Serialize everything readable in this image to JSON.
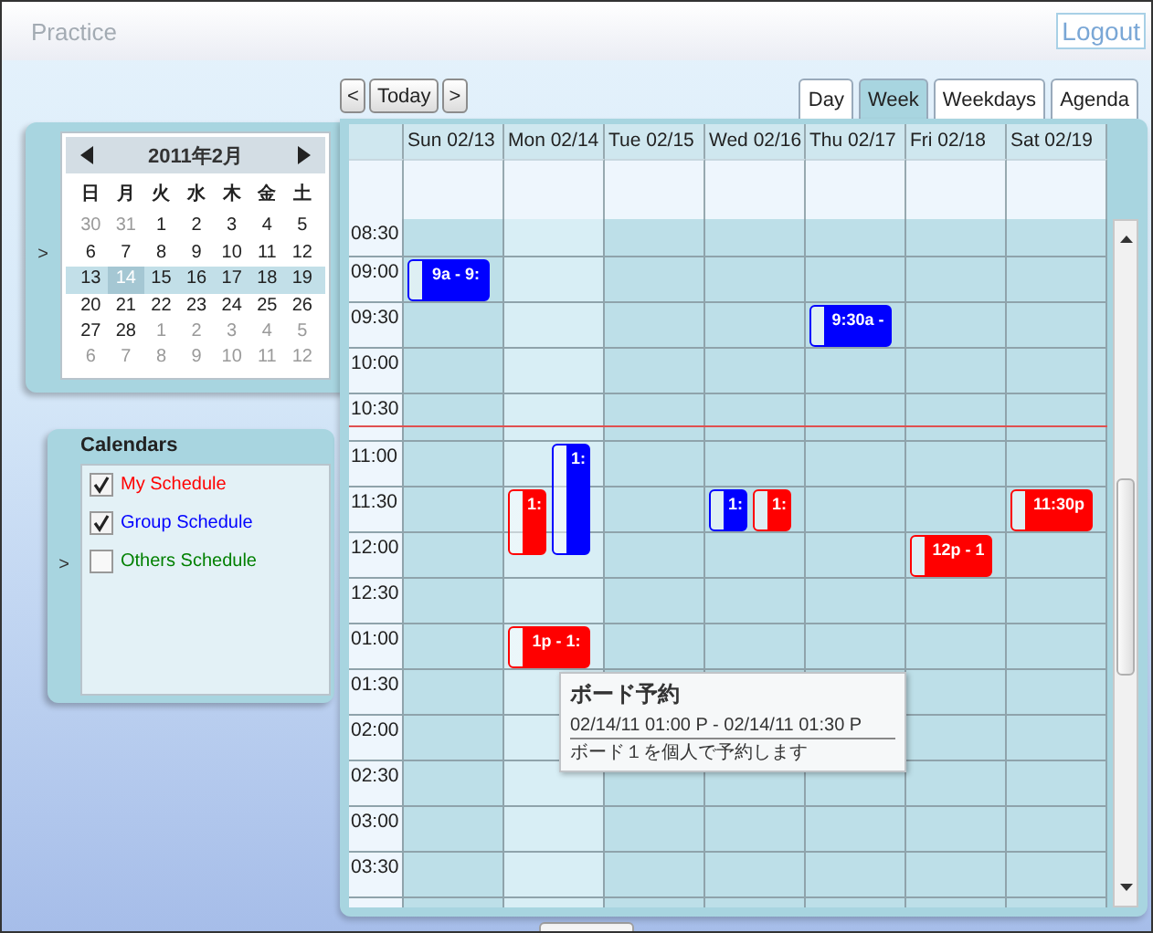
{
  "header": {
    "title": "Practice",
    "logout": "Logout"
  },
  "nav": {
    "prev": "<",
    "today": "Today",
    "next": ">"
  },
  "view_tabs": [
    {
      "label": "Day",
      "selected": false
    },
    {
      "label": "Week",
      "selected": true
    },
    {
      "label": "Weekdays",
      "selected": false
    },
    {
      "label": "Agenda",
      "selected": false
    }
  ],
  "mini_calendar": {
    "expander": ">",
    "month": "2011年2月",
    "weekdays": [
      "日",
      "月",
      "火",
      "水",
      "木",
      "金",
      "土"
    ],
    "weeks": [
      {
        "selected": false,
        "days": [
          {
            "text": "30",
            "other_month": true,
            "today": false
          },
          {
            "text": "31",
            "other_month": true,
            "today": false
          },
          {
            "text": "1",
            "other_month": false,
            "today": false
          },
          {
            "text": "2",
            "other_month": false,
            "today": false
          },
          {
            "text": "3",
            "other_month": false,
            "today": false
          },
          {
            "text": "4",
            "other_month": false,
            "today": false
          },
          {
            "text": "5",
            "other_month": false,
            "today": false
          }
        ]
      },
      {
        "selected": false,
        "days": [
          {
            "text": "6",
            "other_month": false,
            "today": false
          },
          {
            "text": "7",
            "other_month": false,
            "today": false
          },
          {
            "text": "8",
            "other_month": false,
            "today": false
          },
          {
            "text": "9",
            "other_month": false,
            "today": false
          },
          {
            "text": "10",
            "other_month": false,
            "today": false
          },
          {
            "text": "11",
            "other_month": false,
            "today": false
          },
          {
            "text": "12",
            "other_month": false,
            "today": false
          }
        ]
      },
      {
        "selected": true,
        "days": [
          {
            "text": "13",
            "other_month": false,
            "today": false
          },
          {
            "text": "14",
            "other_month": false,
            "today": true
          },
          {
            "text": "15",
            "other_month": false,
            "today": false
          },
          {
            "text": "16",
            "other_month": false,
            "today": false
          },
          {
            "text": "17",
            "other_month": false,
            "today": false
          },
          {
            "text": "18",
            "other_month": false,
            "today": false
          },
          {
            "text": "19",
            "other_month": false,
            "today": false
          }
        ]
      },
      {
        "selected": false,
        "days": [
          {
            "text": "20",
            "other_month": false,
            "today": false
          },
          {
            "text": "21",
            "other_month": false,
            "today": false
          },
          {
            "text": "22",
            "other_month": false,
            "today": false
          },
          {
            "text": "23",
            "other_month": false,
            "today": false
          },
          {
            "text": "24",
            "other_month": false,
            "today": false
          },
          {
            "text": "25",
            "other_month": false,
            "today": false
          },
          {
            "text": "26",
            "other_month": false,
            "today": false
          }
        ]
      },
      {
        "selected": false,
        "days": [
          {
            "text": "27",
            "other_month": false,
            "today": false
          },
          {
            "text": "28",
            "other_month": false,
            "today": false
          },
          {
            "text": "1",
            "other_month": true,
            "today": false
          },
          {
            "text": "2",
            "other_month": true,
            "today": false
          },
          {
            "text": "3",
            "other_month": true,
            "today": false
          },
          {
            "text": "4",
            "other_month": true,
            "today": false
          },
          {
            "text": "5",
            "other_month": true,
            "today": false
          }
        ]
      },
      {
        "selected": false,
        "days": [
          {
            "text": "6",
            "other_month": true,
            "today": false
          },
          {
            "text": "7",
            "other_month": true,
            "today": false
          },
          {
            "text": "8",
            "other_month": true,
            "today": false
          },
          {
            "text": "9",
            "other_month": true,
            "today": false
          },
          {
            "text": "10",
            "other_month": true,
            "today": false
          },
          {
            "text": "11",
            "other_month": true,
            "today": false
          },
          {
            "text": "12",
            "other_month": true,
            "today": false
          }
        ]
      }
    ]
  },
  "calendars": {
    "expander": ">",
    "title": "Calendars",
    "items": [
      {
        "label": "My Schedule",
        "checked": true,
        "color": "#ff0000"
      },
      {
        "label": "Group Schedule",
        "checked": true,
        "color": "#0000ff"
      },
      {
        "label": "Others Schedule",
        "checked": false,
        "color": "#008000"
      }
    ]
  },
  "week": {
    "days": [
      {
        "label": "Sun 02/13",
        "today": false
      },
      {
        "label": "Mon 02/14",
        "today": true
      },
      {
        "label": "Tue 02/15",
        "today": false
      },
      {
        "label": "Wed 02/16",
        "today": false
      },
      {
        "label": "Thu 02/17",
        "today": false
      },
      {
        "label": "Fri 02/18",
        "today": false
      },
      {
        "label": "Sat 02/19",
        "today": false
      }
    ],
    "rows": [
      {
        "time": "08:30",
        "now_line": false
      },
      {
        "time": "09:00",
        "now_line": false,
        "cells": [
          {
            "events": [
              {
                "kind": "short",
                "text": "9a - 9:",
                "color": "#0000ff"
              }
            ]
          },
          {},
          {},
          {},
          {},
          {},
          {}
        ]
      },
      {
        "time": "09:30",
        "now_line": false,
        "cells": [
          {},
          {},
          {},
          {},
          {
            "events": [
              {
                "kind": "short",
                "text": "9:30a -",
                "color": "#0000ff"
              }
            ]
          },
          {},
          {}
        ]
      },
      {
        "time": "10:00",
        "now_line": false
      },
      {
        "time": "10:30",
        "now_line": true
      },
      {
        "time": "11:00",
        "now_line": false,
        "cells": [
          {},
          {
            "events": [
              {
                "kind": "long",
                "text": "1:",
                "color": "#0000ff"
              }
            ]
          },
          {},
          {},
          {},
          {},
          {}
        ]
      },
      {
        "time": "11:30",
        "now_line": false,
        "cells": [
          {},
          {
            "events": [
              {
                "kind": "medium",
                "text": "1:",
                "color": "#ff0000"
              }
            ]
          },
          {},
          {
            "events": [
              {
                "kind": "short",
                "text": "1:",
                "color": "#0000ff"
              },
              {
                "kind": "short",
                "text": "1:",
                "color": "#ff0000"
              }
            ]
          },
          {},
          {},
          {
            "events": [
              {
                "kind": "short",
                "text": "11:30p",
                "color": "#ff0000"
              }
            ]
          }
        ]
      },
      {
        "time": "12:00",
        "now_line": false,
        "cells": [
          {},
          {},
          {},
          {},
          {},
          {
            "events": [
              {
                "kind": "short",
                "text": "12p - 1",
                "color": "#ff0000"
              }
            ]
          },
          {}
        ]
      },
      {
        "time": "12:30",
        "now_line": false
      },
      {
        "time": "01:00",
        "now_line": false,
        "cells": [
          {},
          {
            "events": [
              {
                "kind": "short",
                "text": "1p - 1:",
                "color": "#ff0000",
                "tooltip": {
                  "title": "ボード予約",
                  "time_range": "02/14/11 01:00 P - 02/14/11 01:30 P",
                  "description": "ボード１を個人で予約します"
                }
              }
            ]
          },
          {},
          {},
          {},
          {},
          {}
        ]
      },
      {
        "time": "01:30",
        "now_line": false
      },
      {
        "time": "02:00",
        "now_line": false
      },
      {
        "time": "02:30",
        "now_line": false
      },
      {
        "time": "03:00",
        "now_line": false
      },
      {
        "time": "03:30",
        "now_line": false
      }
    ]
  }
}
